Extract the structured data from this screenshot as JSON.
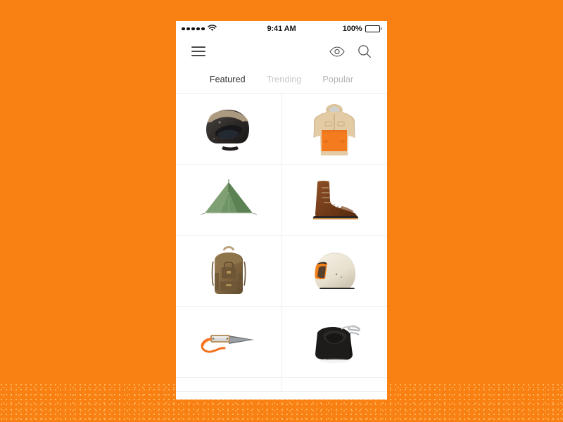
{
  "theme": {
    "background_color": "#F98012",
    "screen_color": "#FFFFFF",
    "accent_color": "#F98012",
    "grid_line_color": "#EEEEEE",
    "active_tab_color": "#2E2E2E",
    "inactive_tab_color": "#C9C9C9"
  },
  "status_bar": {
    "signal_dots": 5,
    "signal_icon": "signal-dots-icon",
    "wifi_icon": "wifi-icon",
    "time": "9:41 AM",
    "battery_percent": "100%",
    "battery_icon": "battery-full-icon"
  },
  "nav_bar": {
    "menu_icon": "hamburger-menu-icon",
    "eye_icon": "eye-icon",
    "search_icon": "search-icon"
  },
  "tabs": [
    {
      "label": "Featured",
      "active": true,
      "state": "active"
    },
    {
      "label": "Trending",
      "active": false,
      "state": "inactive"
    },
    {
      "label": "Popular",
      "active": false,
      "state": "inactive-dim"
    }
  ],
  "grid": {
    "columns": 2,
    "items": [
      {
        "name": "Open Face Motorcycle Helmet",
        "icon": "product-helmet-open-face",
        "colors": [
          "#2e2b29",
          "#c7b49a"
        ]
      },
      {
        "name": "Anorak Jacket",
        "icon": "product-anorak-jacket",
        "colors": [
          "#e4cba4",
          "#f57b1f"
        ]
      },
      {
        "name": "Camping Tent",
        "icon": "product-camping-tent",
        "colors": [
          "#6f9466",
          "#4e7247"
        ]
      },
      {
        "name": "Leather Boot",
        "icon": "product-leather-boot",
        "colors": [
          "#7b4423",
          "#522d15"
        ]
      },
      {
        "name": "Canvas Backpack",
        "icon": "product-canvas-backpack",
        "colors": [
          "#8a6f४b",
          "#6b5536"
        ]
      },
      {
        "name": "Full Face Helmet",
        "icon": "product-helmet-full-face",
        "colors": [
          "#efe9db",
          "#f58220"
        ]
      },
      {
        "name": "Folding Pocket Knife",
        "icon": "product-pocket-knife",
        "colors": [
          "#5a5a5a",
          "#f4711c"
        ]
      },
      {
        "name": "Motorcycle Saddle Bag",
        "icon": "product-saddle-bag",
        "colors": [
          "#1d1d1d",
          "#b9bcbe"
        ]
      },
      {
        "name": "Next Item Left",
        "icon": "product-partial-left",
        "colors": [
          "#ffffff"
        ]
      },
      {
        "name": "Next Item Right",
        "icon": "product-partial-right",
        "colors": [
          "#ffffff"
        ]
      }
    ]
  }
}
